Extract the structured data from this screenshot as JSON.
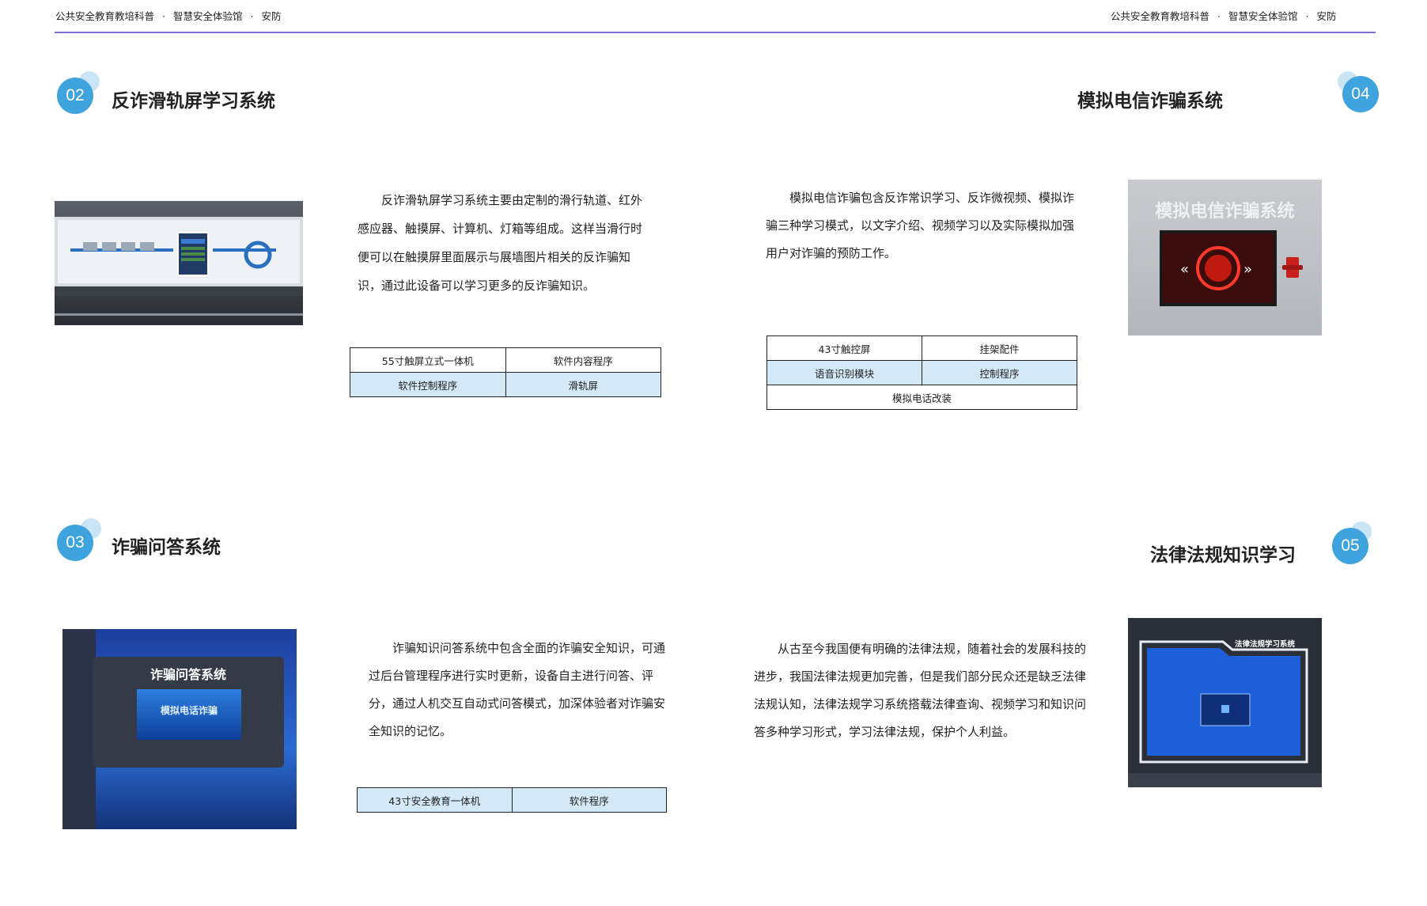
{
  "header": {
    "left": [
      "公共安全教育教培科普",
      "智慧安全体验馆",
      "安防"
    ],
    "right": [
      "公共安全教育教培科普",
      "智慧安全体验馆",
      "安防"
    ],
    "separator": "·"
  },
  "sections": [
    {
      "number": "02",
      "title": "反诈滑轨屏学习系统",
      "paragraph": "反诈滑轨屏学习系统主要由定制的滑行轨道、红外感应器、触摸屏、计算机、灯箱等组成。这样当滑行时便可以在触摸屏里面展示与展墙图片相关的反诈骗知识，通过此设备可以学习更多的反诈骗知识。",
      "specs": [
        [
          "55寸触屏立式一体机",
          "软件内容程序"
        ],
        [
          "软件控制程序",
          "滑轨屏"
        ]
      ]
    },
    {
      "number": "04",
      "title": "模拟电信诈骗系统",
      "paragraph": "模拟电信诈骗包含反诈常识学习、反诈微视频、模拟诈骗三种学习模式，以文字介绍、视频学习以及实际模拟加强用户对诈骗的预防工作。",
      "specs": [
        [
          "43寸触控屏",
          "挂架配件"
        ],
        [
          "语音识别模块",
          "控制程序"
        ],
        [
          "模拟电话改装"
        ]
      ],
      "photo_text": "模拟电信诈骗系统"
    },
    {
      "number": "03",
      "title": "诈骗问答系统",
      "paragraph": "诈骗知识问答系统中包含全面的诈骗安全知识，可通过后台管理程序进行实时更新，设备自主进行问答、评分，通过人机交互自动式问答模式，加深体验者对诈骗安全知识的记忆。",
      "specs": [
        [
          "43寸安全教育一体机",
          "软件程序"
        ]
      ],
      "photo_text": "诈骗问答系统",
      "screen_text": "模拟电话诈骗"
    },
    {
      "number": "05",
      "title": "法律法规知识学习",
      "paragraph": "从古至今我国便有明确的法律法规，随着社会的发展科技的进步，我国法律法规更加完善，但是我们部分民众还是缺乏法律法规认知，法律法规学习系统搭载法律查询、视频学习和知识问答多种学习形式，学习法律法规，保护个人利益。",
      "photo_text": "法律法规学习系统"
    }
  ],
  "colors": {
    "accent_circle": "#3fa3dd",
    "accent_bubble": "#c9e4f5",
    "header_line": "#7a6cd6",
    "table_highlight": "#d4e9f8"
  }
}
